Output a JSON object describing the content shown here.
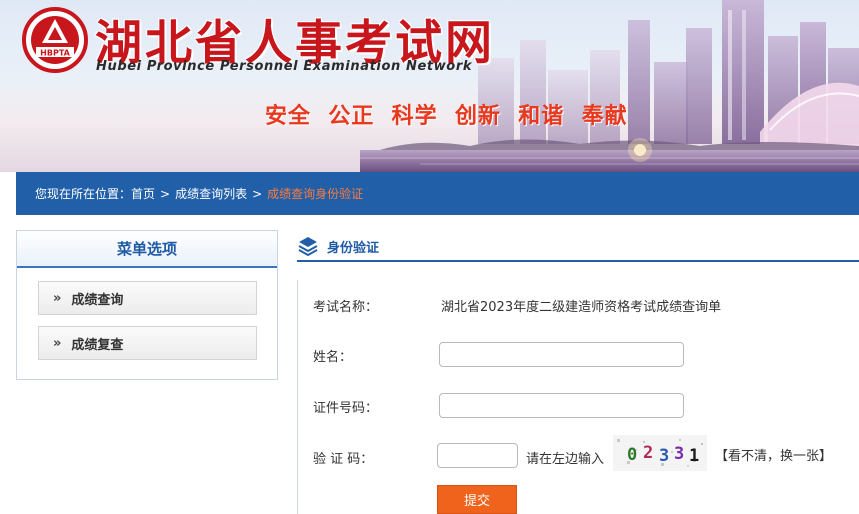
{
  "header": {
    "title": "湖北省人事考试网",
    "subtitle": "Hubei Province Personnel Examination Network",
    "logo_text": "HBPTA",
    "slogan": "安全  公正  科学  创新  和谐  奉献"
  },
  "breadcrumb": {
    "prefix": "您现在所在位置：",
    "items": [
      "首页",
      "成绩查询列表"
    ],
    "separator": ">",
    "current": "成绩查询身份验证"
  },
  "sidebar": {
    "heading": "菜单选项",
    "items": [
      {
        "label": "成绩查询"
      },
      {
        "label": "成绩复查"
      }
    ]
  },
  "panel": {
    "title": "身份验证",
    "exam_name_label": "考试名称：",
    "exam_name_value": "湖北省2023年度二级建造师资格考试成绩查询单",
    "name_label": "姓名：",
    "name_value": "",
    "id_label": "证件号码：",
    "id_value": "",
    "captcha_label": "验 证 码：",
    "captcha_value": "",
    "captcha_hint": "请在左边输入",
    "captcha_chars": [
      "0",
      "2",
      "3",
      "3",
      "1"
    ],
    "captcha_refresh": "【看不清，换一张】",
    "submit_label": "提交"
  },
  "colors": {
    "brand_red": "#c8161d",
    "nav_blue": "#2160a8",
    "accent_orange": "#f0631d",
    "slogan_red": "#e8381d"
  }
}
